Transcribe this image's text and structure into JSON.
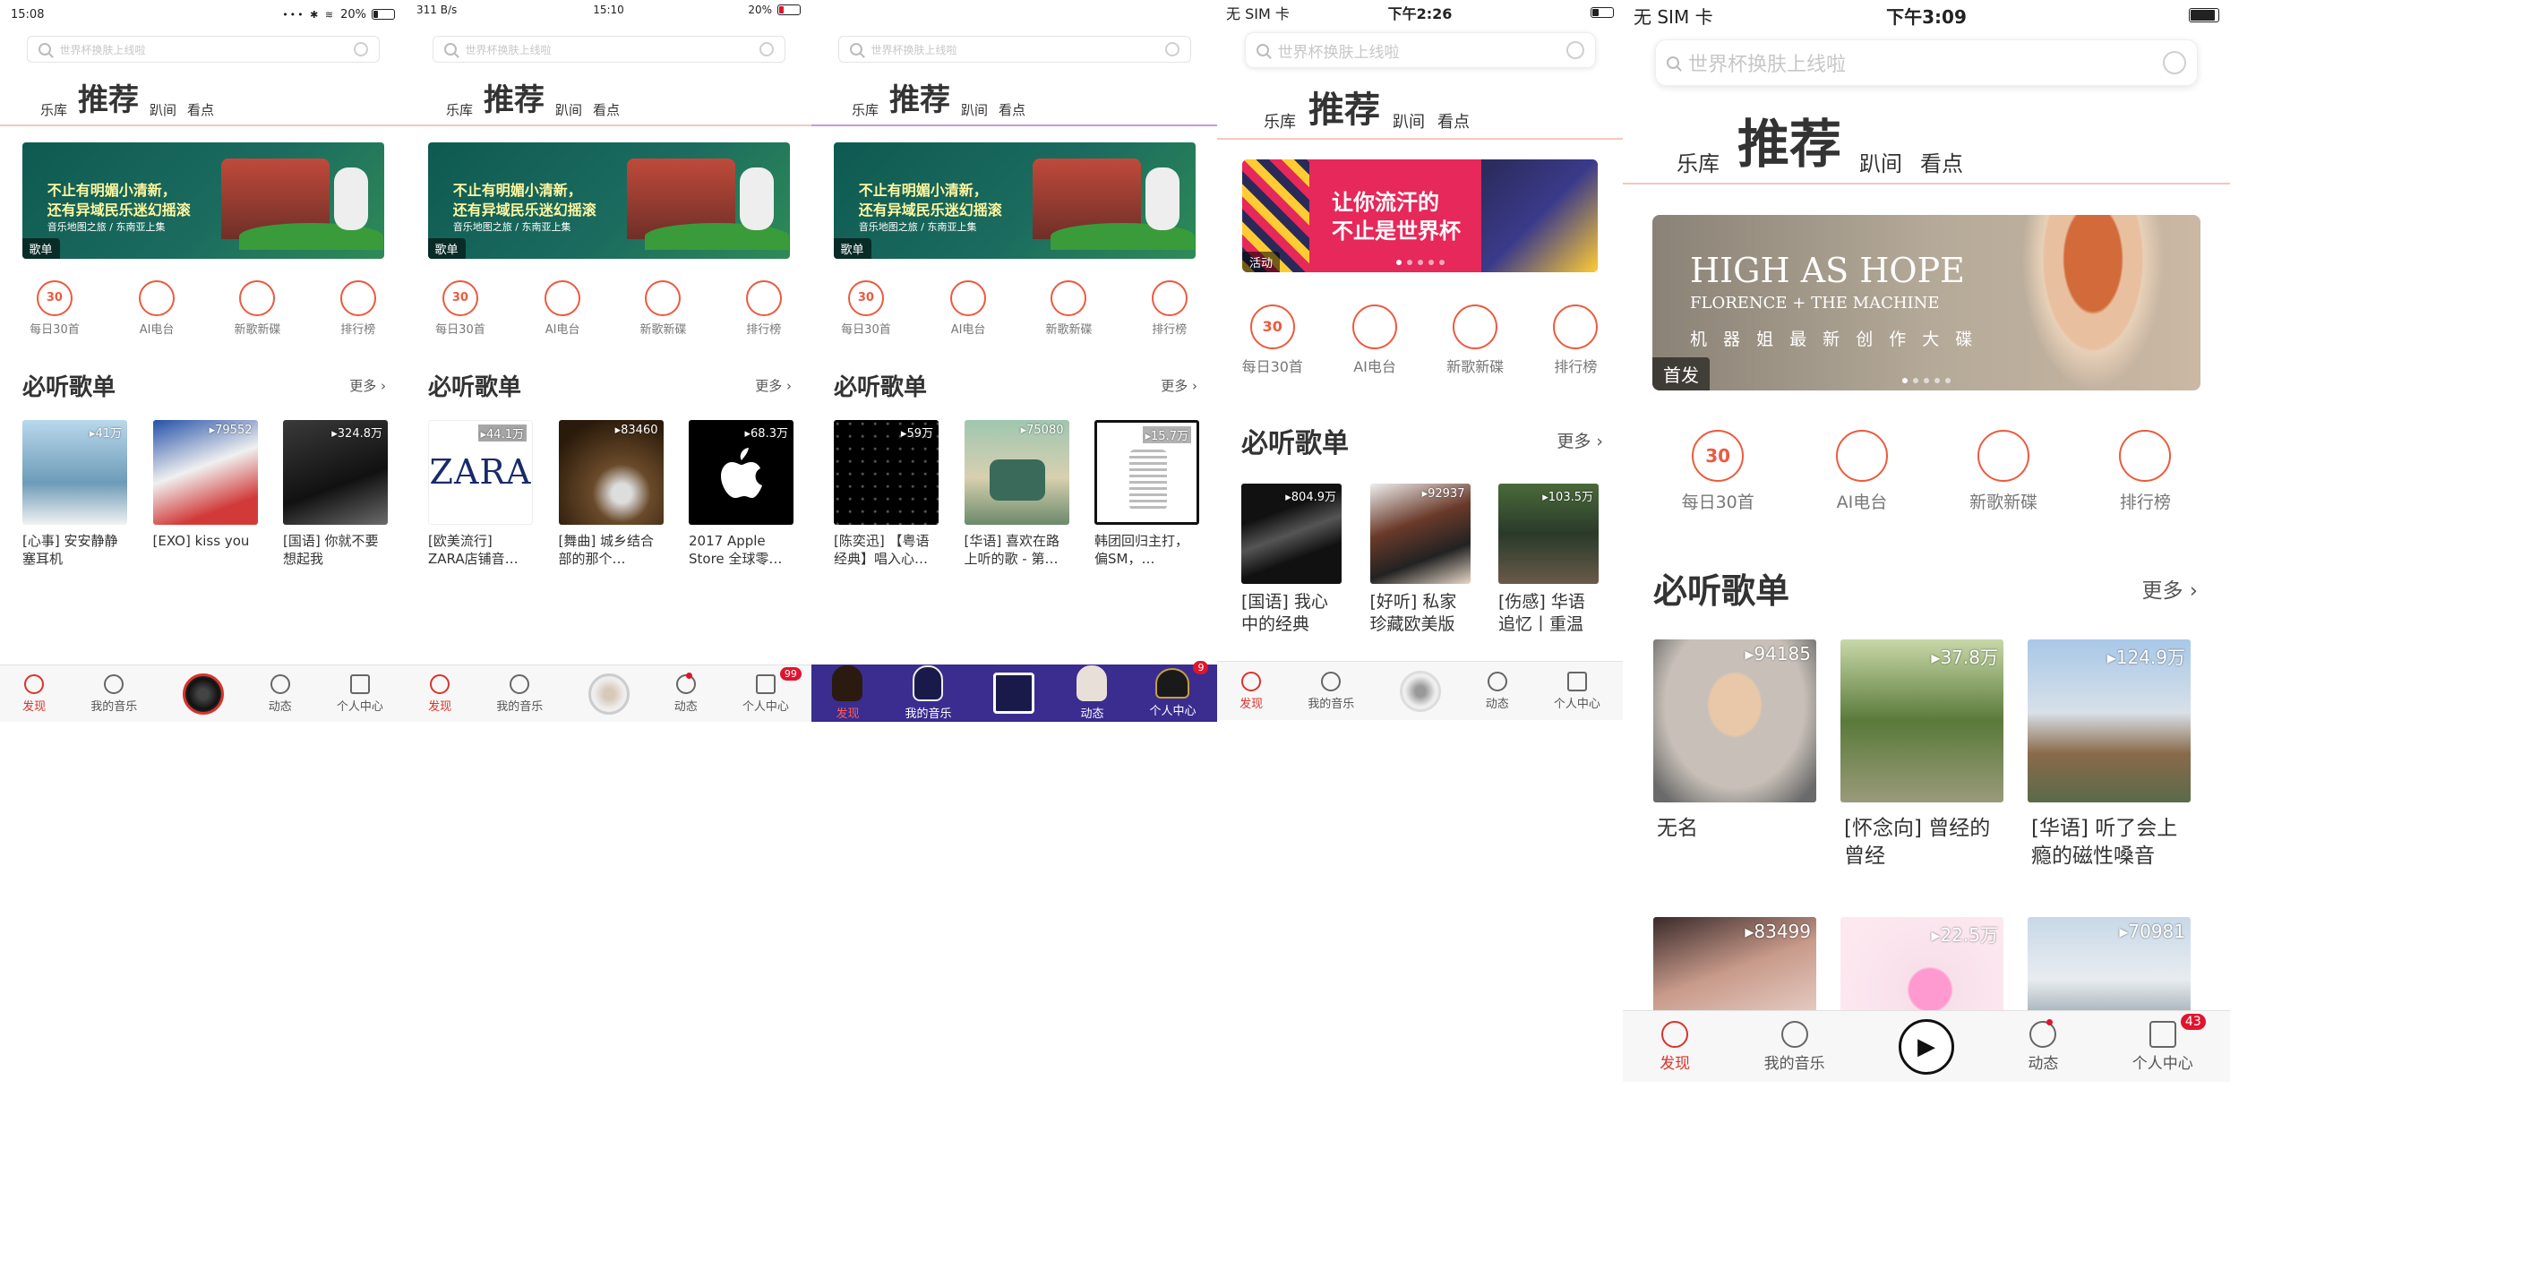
{
  "colors": {
    "accent": "#d8342c",
    "icon_orange": "#ec5a3e",
    "nav_purple": "#3a2d8f"
  },
  "shortcuts": [
    "每日30首",
    "AI电台",
    "新歌新碟",
    "排行榜"
  ],
  "shortcut_badge": "30",
  "tabs": {
    "left": "乐库",
    "active": "推荐",
    "mid": "趴间",
    "right": "看点"
  },
  "search_placeholder": "世界杯换肤上线啦",
  "section": {
    "title": "必听歌单",
    "more": "更多 ›"
  },
  "nav_labels": [
    "发现",
    "我的音乐",
    "",
    "动态",
    "个人中心"
  ],
  "screens": [
    {
      "status": {
        "left": "15:08",
        "center": "",
        "right": "20%"
      },
      "banner": {
        "line1": "不止有明媚小清新，",
        "line2": "还有异域民乐迷幻摇滚",
        "line3": "音乐地图之旅 / 东南亚上集",
        "tag": "歌单"
      },
      "cards": [
        {
          "count": "▸41万",
          "title": "[心事] 安安静静塞耳机"
        },
        {
          "count": "▸79552",
          "title": "[EXO] kiss you"
        },
        {
          "count": "▸324.8万",
          "title": "[国语] 你就不要想起我"
        }
      ],
      "nav_badge": ""
    },
    {
      "status": {
        "left": "311 B/s",
        "center": "15:10",
        "right": "20%"
      },
      "banner": {
        "line1": "不止有明媚小清新，",
        "line2": "还有异域民乐迷幻摇滚",
        "line3": "音乐地图之旅 / 东南亚上集",
        "tag": "歌单"
      },
      "cards": [
        {
          "count": "▸44.1万",
          "title": "[欧美流行] ZARA店铺音…",
          "cover_text": "ZARA"
        },
        {
          "count": "▸83460",
          "title": "[舞曲] 城乡结合部的那个…"
        },
        {
          "count": "▸68.3万",
          "title": "2017 Apple Store 全球零…"
        }
      ],
      "nav_badge": "99"
    },
    {
      "status": {
        "left": "",
        "center": "",
        "right": ""
      },
      "banner": {
        "line1": "不止有明媚小清新，",
        "line2": "还有异域民乐迷幻摇滚",
        "line3": "音乐地图之旅 / 东南亚上集",
        "tag": "歌单"
      },
      "cards": [
        {
          "count": "▸59万",
          "title": "[陈奕迅] 【粤语经典】唱入心…"
        },
        {
          "count": "▸75080",
          "title": "[华语] 喜欢在路上听的歌 - 第…"
        },
        {
          "count": "▸15.7万",
          "title": "韩团回归主打，偏SM，…"
        }
      ],
      "nav_badge": "9"
    },
    {
      "status": {
        "left": "无 SIM 卡",
        "center": "下午2:26",
        "right": ""
      },
      "banner": {
        "line1": "让你流汗的",
        "line2": "不止是世界杯",
        "line3": "",
        "tag": "活动"
      },
      "cards": [
        {
          "count": "▸804.9万",
          "title": "[国语] 我心中的经典"
        },
        {
          "count": "▸92937",
          "title": "[好听] 私家珍藏欧美版【…"
        },
        {
          "count": "▸103.5万",
          "title": "[伤感] 华语追忆丨重温昔…"
        }
      ],
      "nav_badge": ""
    },
    {
      "status": {
        "left": "无 SIM 卡",
        "center": "下午3:09",
        "right": ""
      },
      "banner": {
        "line1": "HIGH AS HOPE",
        "line2": "FLORENCE + THE MACHINE",
        "line3": "机 器 姐 最 新 创 作 大 碟",
        "tag": "首发"
      },
      "cards": [
        {
          "count": "▸94185",
          "title": "无名"
        },
        {
          "count": "▸37.8万",
          "title": "[怀念向] 曾经的曾经"
        },
        {
          "count": "▸124.9万",
          "title": "[华语] 听了会上瘾的磁性嗓音——…"
        }
      ],
      "cards2": [
        {
          "count": "▸83499"
        },
        {
          "count": "▸22.5万"
        },
        {
          "count": "▸70981"
        }
      ],
      "nav_badge": "43"
    }
  ]
}
